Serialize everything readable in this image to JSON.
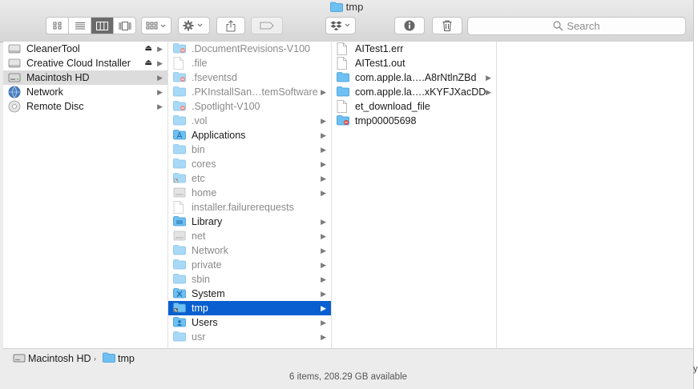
{
  "window": {
    "title": "tmp"
  },
  "toolbar": {
    "search_placeholder": "Search"
  },
  "sidebar": {
    "items": [
      {
        "label": "CleanerTool",
        "icon": "drive-icon",
        "eject": true
      },
      {
        "label": "Creative Cloud Installer",
        "icon": "drive-icon",
        "eject": true
      },
      {
        "label": "Macintosh HD",
        "icon": "hard-disk-icon",
        "selected": true
      },
      {
        "label": "Network",
        "icon": "globe-icon"
      },
      {
        "label": "Remote Disc",
        "icon": "disc-icon"
      }
    ]
  },
  "column2": {
    "items": [
      {
        "label": ".DocumentRevisions-V100",
        "dim": true,
        "icon": "restricted-folder",
        "arrow": false
      },
      {
        "label": ".file",
        "dim": true,
        "icon": "file",
        "arrow": false
      },
      {
        "label": ".fseventsd",
        "dim": true,
        "icon": "restricted-folder",
        "arrow": false
      },
      {
        "label": ".PKInstallSan…temSoftware",
        "dim": true,
        "icon": "folder",
        "arrow": true
      },
      {
        "label": ".Spotlight-V100",
        "dim": true,
        "icon": "restricted-folder",
        "arrow": false
      },
      {
        "label": ".vol",
        "dim": true,
        "icon": "folder",
        "arrow": true
      },
      {
        "label": "Applications",
        "dim": false,
        "icon": "apps-folder",
        "arrow": true
      },
      {
        "label": "bin",
        "dim": true,
        "icon": "folder",
        "arrow": true
      },
      {
        "label": "cores",
        "dim": true,
        "icon": "folder",
        "arrow": true
      },
      {
        "label": "etc",
        "dim": true,
        "icon": "alias-folder",
        "arrow": true
      },
      {
        "label": "home",
        "dim": true,
        "icon": "drive-folder",
        "arrow": true
      },
      {
        "label": "installer.failurerequests",
        "dim": true,
        "icon": "file",
        "arrow": false
      },
      {
        "label": "Library",
        "dim": false,
        "icon": "library-folder",
        "arrow": true
      },
      {
        "label": "net",
        "dim": true,
        "icon": "drive-folder",
        "arrow": true
      },
      {
        "label": "Network",
        "dim": true,
        "icon": "folder",
        "arrow": true
      },
      {
        "label": "private",
        "dim": true,
        "icon": "folder",
        "arrow": true
      },
      {
        "label": "sbin",
        "dim": true,
        "icon": "folder",
        "arrow": true
      },
      {
        "label": "System",
        "dim": false,
        "icon": "system-folder",
        "arrow": true
      },
      {
        "label": "tmp",
        "dim": false,
        "icon": "alias-folder",
        "arrow": true,
        "selected": true
      },
      {
        "label": "Users",
        "dim": false,
        "icon": "users-folder",
        "arrow": true
      },
      {
        "label": "usr",
        "dim": true,
        "icon": "folder",
        "arrow": true
      }
    ]
  },
  "column3": {
    "items": [
      {
        "label": "AITest1.err",
        "icon": "file",
        "arrow": false
      },
      {
        "label": "AITest1.out",
        "icon": "file",
        "arrow": false
      },
      {
        "label": "com.apple.la….A8rNtlnZBd",
        "icon": "folder",
        "arrow": true
      },
      {
        "label": "com.apple.la….xKYFJXacDD",
        "icon": "folder",
        "arrow": true
      },
      {
        "label": "et_download_file",
        "icon": "file",
        "arrow": false
      },
      {
        "label": "tmp00005698",
        "icon": "restricted-folder",
        "arrow": false
      }
    ]
  },
  "pathbar": {
    "root": "Macintosh HD",
    "current": "tmp"
  },
  "status": {
    "text": "6 items, 208.29 GB available"
  },
  "edge_stub": "y",
  "colors": {
    "selection_blue": "#0a5fd0",
    "folder_blue": "#5fb7ee"
  }
}
